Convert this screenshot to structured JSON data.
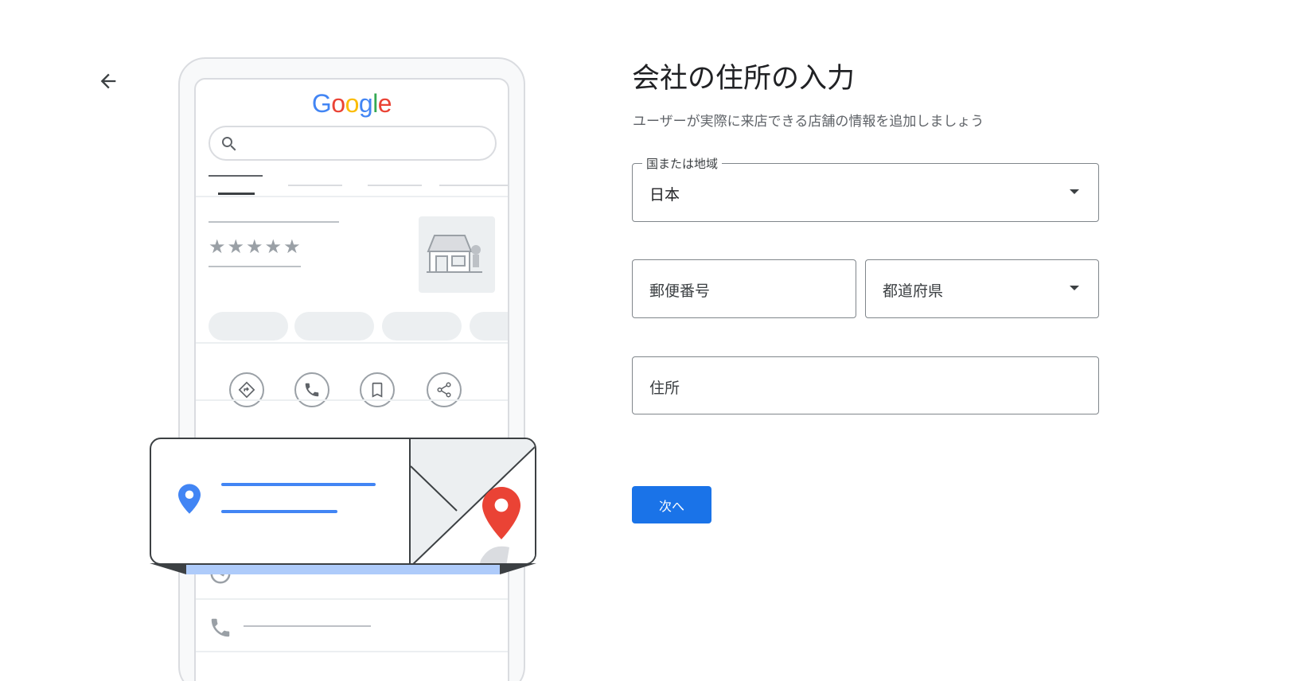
{
  "navigation": {
    "back_icon": "arrow-back-icon"
  },
  "illustration": {
    "logo_text": [
      "G",
      "o",
      "o",
      "g",
      "l",
      "e"
    ],
    "logo_colors": [
      "#4285f4",
      "#ea4335",
      "#fbbc05",
      "#4285f4",
      "#34a853",
      "#ea4335"
    ],
    "stars": "★★★★★",
    "icons": [
      "search-icon",
      "directions-icon",
      "phone-icon",
      "bookmark-icon",
      "share-icon",
      "location-pin-icon",
      "map-pin-icon",
      "clock-icon",
      "phone-icon"
    ]
  },
  "form": {
    "title": "会社の住所の入力",
    "subtitle": "ユーザーが実際に来店できる店舗の情報を追加しましょう",
    "country": {
      "label": "国または地域",
      "value": "日本"
    },
    "postal_code": {
      "placeholder": "郵便番号"
    },
    "prefecture": {
      "placeholder": "都道府県"
    },
    "address": {
      "placeholder": "住所"
    },
    "next_button": "次へ"
  },
  "colors": {
    "accent": "#1a73e8",
    "border": "#80868b",
    "pin_red": "#ea4335",
    "pin_blue": "#4285f4"
  }
}
